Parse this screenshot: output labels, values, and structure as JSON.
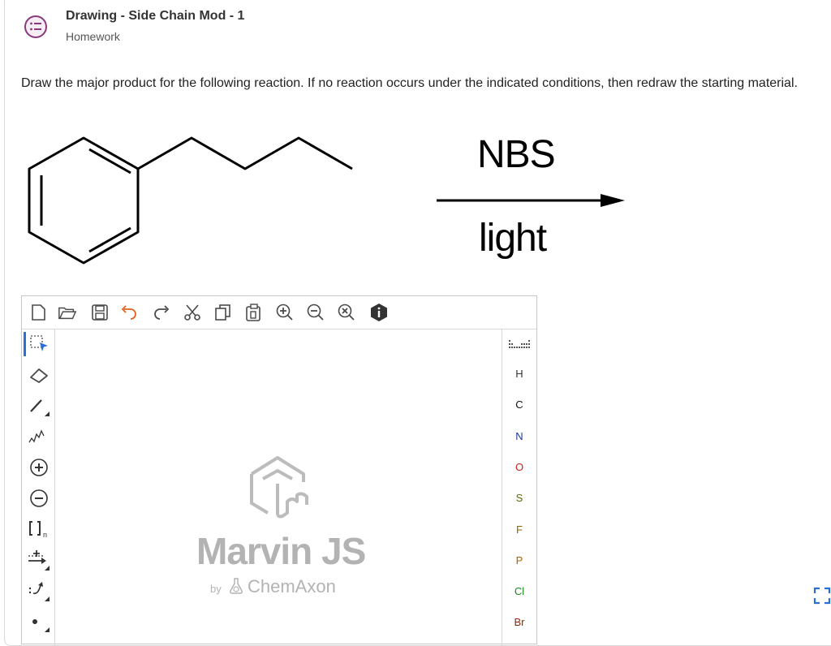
{
  "header": {
    "title": "Drawing - Side Chain Mod - 1",
    "subtitle": "Homework"
  },
  "question": {
    "text": "Draw the major product for the following reaction. If no reaction occurs under the indicated conditions, then redraw the starting material."
  },
  "reaction": {
    "reagent_above": "NBS",
    "reagent_below": "light"
  },
  "editor": {
    "brand": "Marvin JS",
    "byline_prefix": "by",
    "byline_company": "ChemAxon",
    "toolbar_top": [
      "new-document-icon",
      "open-icon",
      "save-icon",
      "undo-icon",
      "redo-icon",
      "cut-icon",
      "copy-icon",
      "paste-icon",
      "zoom-in-icon",
      "zoom-out-icon",
      "zoom-reset-icon",
      "info-icon"
    ],
    "toolbar_left": [
      "select-icon",
      "erase-icon",
      "bond-icon",
      "chain-icon",
      "charge-plus-icon",
      "charge-minus-icon",
      "bracket-icon",
      "reaction-arrow-icon",
      "electron-flow-icon",
      "radical-dot-icon"
    ],
    "periodic_table_label": "periodic-table-icon",
    "elements": [
      {
        "symbol": "H",
        "color": "#333333"
      },
      {
        "symbol": "C",
        "color": "#111111"
      },
      {
        "symbol": "N",
        "color": "#1f3a9a"
      },
      {
        "symbol": "O",
        "color": "#d32020"
      },
      {
        "symbol": "S",
        "color": "#5f6b00"
      },
      {
        "symbol": "F",
        "color": "#8a6a00"
      },
      {
        "symbol": "P",
        "color": "#b36200"
      },
      {
        "symbol": "Cl",
        "color": "#1a8a1a"
      },
      {
        "symbol": "Br",
        "color": "#8a2a0a"
      }
    ]
  },
  "colors": {
    "accent": "#8a3a7c",
    "select_blue": "#2a6fd6"
  }
}
